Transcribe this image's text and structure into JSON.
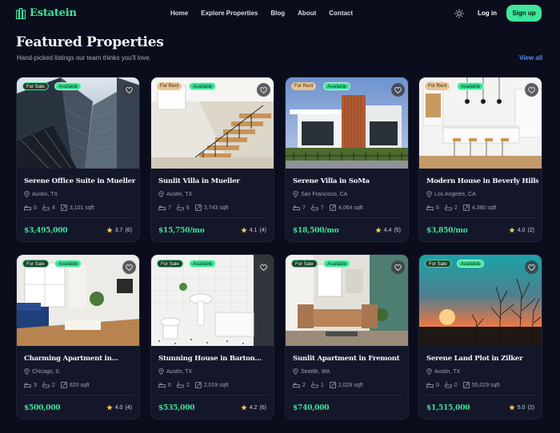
{
  "nav": {
    "brand": "Estatein",
    "links": [
      "Home",
      "Explore Properties",
      "Blog",
      "About",
      "Contact"
    ],
    "login": "Log in",
    "signup": "Sign up",
    "theme_icon": "sun-icon"
  },
  "header": {
    "title": "Featured Properties",
    "subtitle": "Hand-picked listings our team thinks you'll love.",
    "view_all": "View all"
  },
  "colors": {
    "accent": "#3ee59a",
    "link": "#4b8cff",
    "background": "#0b0d1c",
    "card": "#14172a",
    "star": "#f5c542"
  },
  "properties": [
    {
      "type": "For Sale",
      "status": "Available",
      "title": "Serene Office Suite in Mueller",
      "location": "Austin, TX",
      "beds": "0",
      "baths": "4",
      "area": "3,101 sqft",
      "price": "$3,495,000",
      "rating": "3.7",
      "reviews": "(6)",
      "image": "office-towers"
    },
    {
      "type": "For Rent",
      "status": "Available",
      "title": "Sunlit Villa in Mueller",
      "location": "Austin, TX",
      "beds": "7",
      "baths": "6",
      "area": "3,743 sqft",
      "price": "$15,750/mo",
      "rating": "4.1",
      "reviews": "(4)",
      "image": "wooden-staircase"
    },
    {
      "type": "For Rent",
      "status": "Available",
      "title": "Serene Villa in SoMa",
      "location": "San Francisco, CA",
      "beds": "7",
      "baths": "7",
      "area": "4,064 sqft",
      "price": "$18,500/mo",
      "rating": "4.4",
      "reviews": "(5)",
      "image": "modern-house"
    },
    {
      "type": "For Rent",
      "status": "Available",
      "title": "Modern House in Beverly Hills",
      "location": "Los Angeles, CA",
      "beds": "6",
      "baths": "2",
      "area": "4,380 sqft",
      "price": "$3,850/mo",
      "rating": "4.0",
      "reviews": "(2)",
      "image": "white-kitchen"
    },
    {
      "type": "For Sale",
      "status": "Available",
      "title": "Charming Apartment in...",
      "location": "Chicago, IL",
      "beds": "3",
      "baths": "2",
      "area": "820 sqft",
      "price": "$500,000",
      "rating": "4.0",
      "reviews": "(4)",
      "image": "living-room"
    },
    {
      "type": "For Sale",
      "status": "Available",
      "title": "Stunning House in Barton...",
      "location": "Austin, TX",
      "beds": "6",
      "baths": "2",
      "area": "2,019 sqft",
      "price": "$535,000",
      "rating": "4.2",
      "reviews": "(6)",
      "image": "bathroom"
    },
    {
      "type": "For Sale",
      "status": "Available",
      "title": "Sunlit Apartment in Fremont",
      "location": "Seattle, WA",
      "beds": "2",
      "baths": "1",
      "area": "2,029 sqft",
      "price": "$740,000",
      "rating": "",
      "reviews": "",
      "image": "lounge-sofa"
    },
    {
      "type": "For Sale",
      "status": "Available",
      "title": "Serene Land Plot in Zilker",
      "location": "Austin, TX",
      "beds": "0",
      "baths": "0",
      "area": "55,029 sqft",
      "price": "$1,515,000",
      "rating": "5.0",
      "reviews": "(2)",
      "image": "sunset-field"
    }
  ]
}
